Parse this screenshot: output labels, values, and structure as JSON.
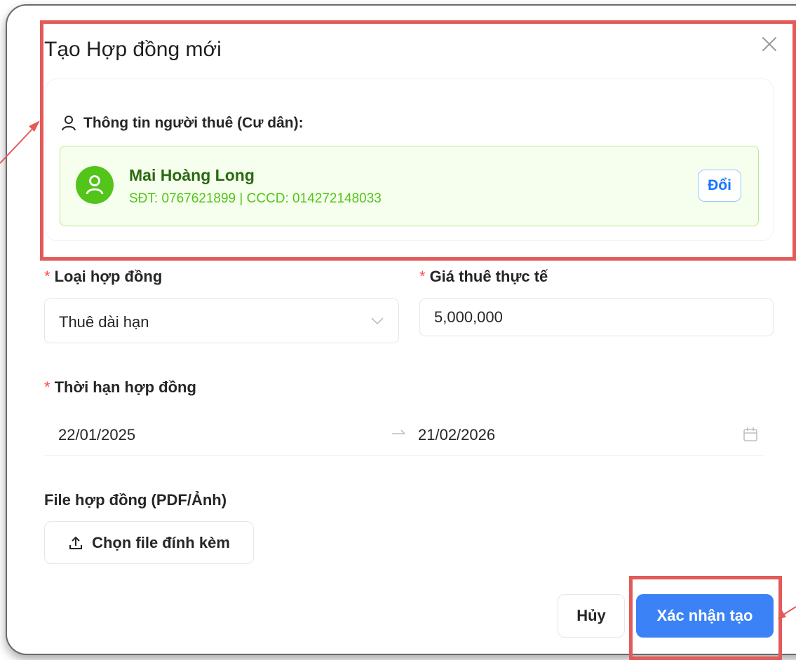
{
  "modal": {
    "title": "Tạo Hợp đồng mới",
    "close_icon": "close-icon"
  },
  "tenant": {
    "heading": "Thông tin người thuê (Cư dân):",
    "heading_icon": "user-icon",
    "name": "Mai Hoàng Long",
    "info": "SĐT: 0767621899 | CCCD: 014272148033",
    "avatar_icon": "user-icon",
    "change_label": "Đổi"
  },
  "contract_type": {
    "label": "Loại hợp đồng",
    "value": "Thuê dài hạn",
    "arrow_icon": "chevron-down-icon"
  },
  "rent_price": {
    "label": "Giá thuê thực tế",
    "value": "5,000,000"
  },
  "duration": {
    "label": "Thời hạn hợp đồng",
    "start": "22/01/2025",
    "end": "21/02/2026",
    "separator_icon": "arrow-right-icon",
    "calendar_icon": "calendar-icon"
  },
  "file": {
    "label": "File hợp đồng (PDF/Ảnh)",
    "button_label": "Chọn file đính kèm",
    "upload_icon": "upload-icon"
  },
  "footer": {
    "cancel_label": "Hủy",
    "confirm_label": "Xác nhận tạo"
  },
  "colors": {
    "required_marker": "#ff4d4f",
    "tenant_bg": "#f6ffed",
    "tenant_border": "#b7eb8f",
    "avatar": "#52c41a",
    "primary": "#3b82f6",
    "annotation_highlight": "#e35a5a"
  }
}
